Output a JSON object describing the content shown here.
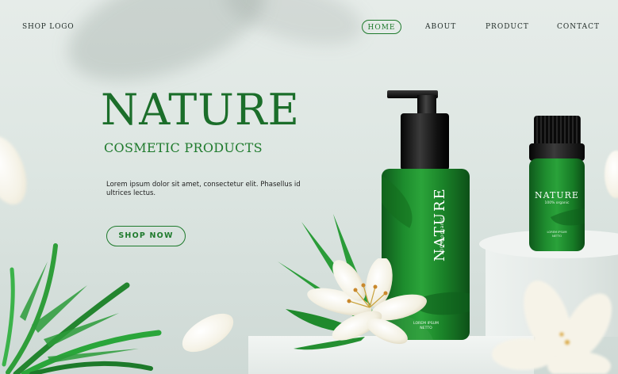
{
  "header": {
    "logo": "SHOP LOGO",
    "nav": [
      {
        "label": "HOME",
        "active": true
      },
      {
        "label": "ABOUT",
        "active": false
      },
      {
        "label": "PRODUCT",
        "active": false
      },
      {
        "label": "CONTACT",
        "active": false
      }
    ]
  },
  "hero": {
    "title": "NATURE",
    "subtitle": "COSMETIC PRODUCTS",
    "body": "Lorem ipsum dolor sit amet, consectetur elit. Phasellus id ultrices lectus.",
    "cta": "SHOP NOW"
  },
  "products": {
    "bottle": {
      "brand": "NATURE",
      "tagline": "100% organic",
      "small_line1": "LOREM IPSUM",
      "small_line2": "NETTO"
    },
    "vial": {
      "brand": "NATURE",
      "tagline": "100% organic",
      "small_line1": "LOREM IPSUM",
      "small_line2": "NETTO"
    }
  },
  "colors": {
    "accent": "#1e7a2c",
    "title": "#1b6e2a",
    "background": "#e3eae7"
  },
  "icons": [
    "palm-leaf-decoration",
    "lily-flower-decoration",
    "petal-decoration"
  ]
}
